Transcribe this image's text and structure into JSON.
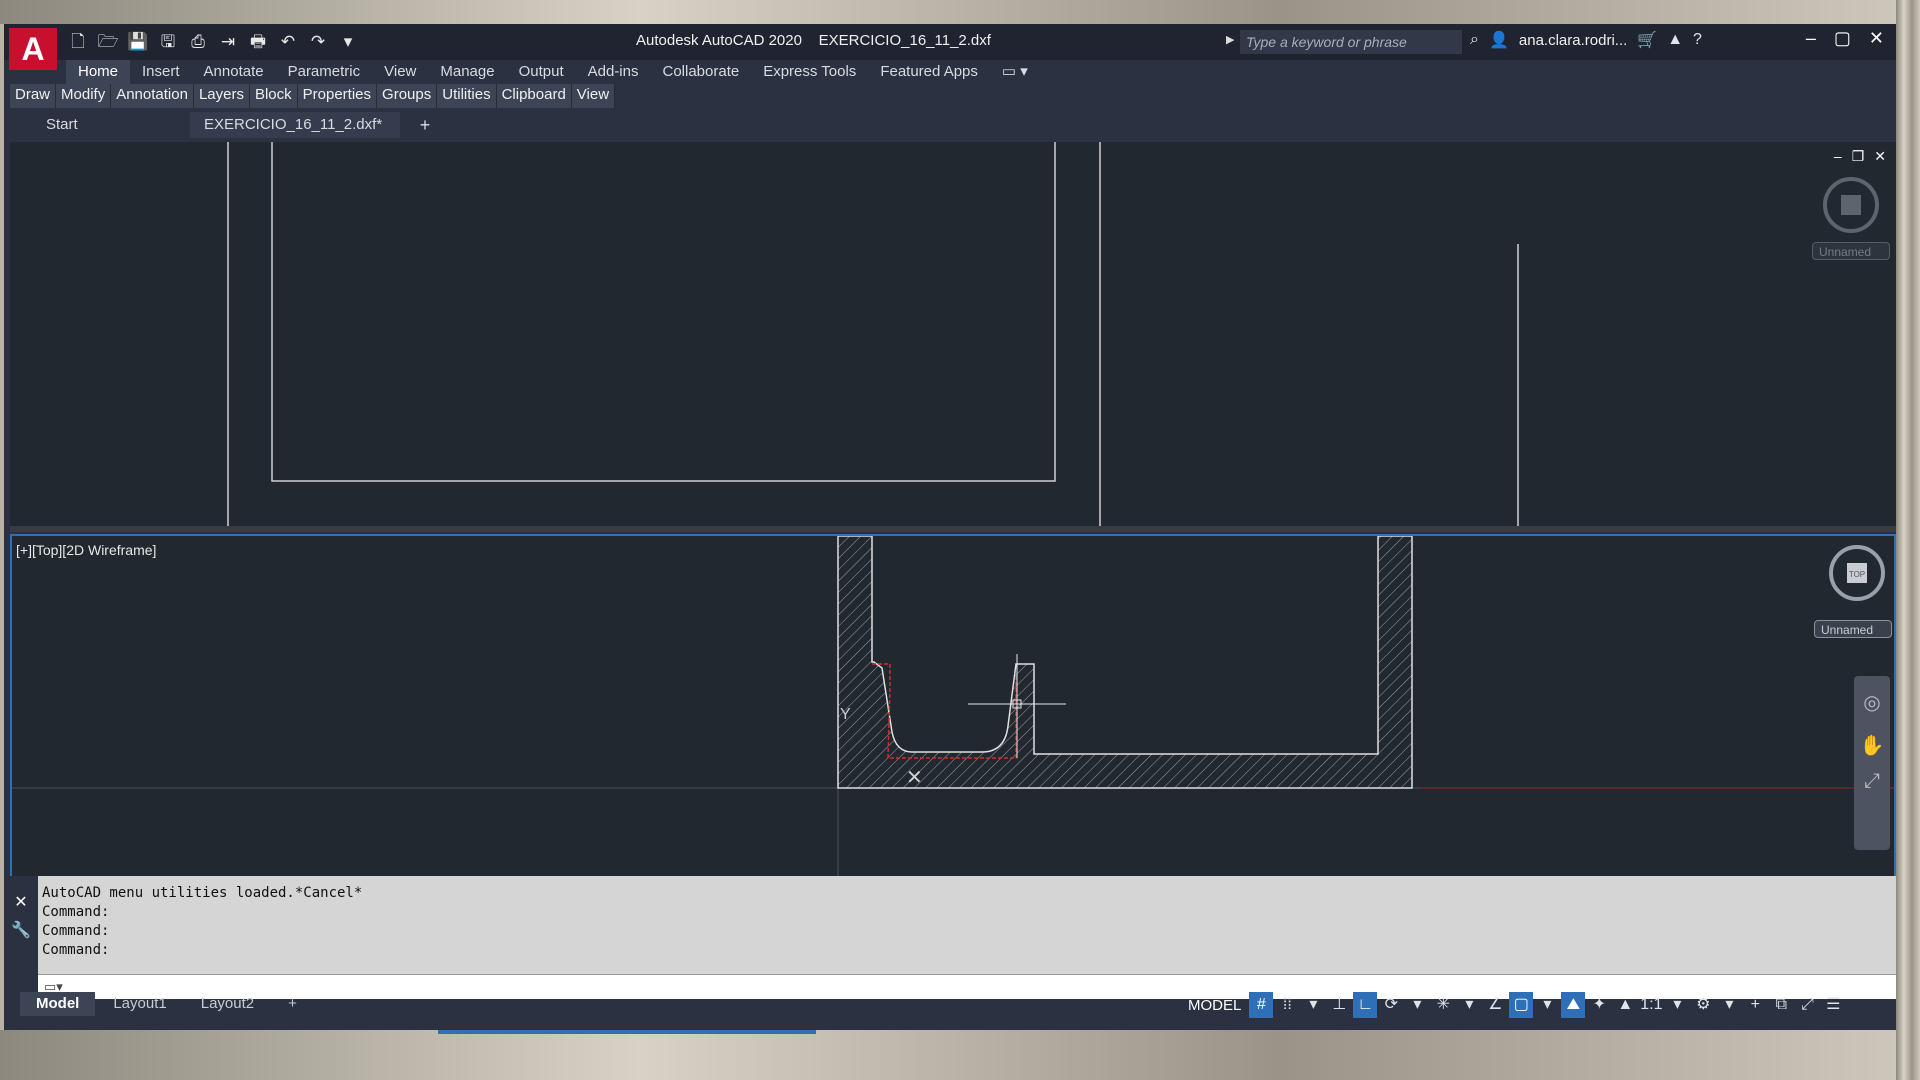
{
  "app": {
    "title": "Autodesk AutoCAD 2020    EXERCICIO_16_11_2.dxf",
    "logo_letter": "A",
    "accent": "#c8102e"
  },
  "qat": {
    "icons": [
      "new-icon",
      "open-icon",
      "save-icon",
      "save-as-icon",
      "plot-icon",
      "import-icon",
      "print-icon",
      "undo-icon",
      "redo-icon",
      "customize-icon"
    ],
    "glyphs": [
      "🗋",
      "🗁",
      "💾",
      "🖫",
      "⎙",
      "⇥",
      "🖶",
      "↶",
      "↷",
      "▾"
    ]
  },
  "search": {
    "placeholder": "Type a keyword or phrase"
  },
  "user": {
    "name": "ana.clara.rodri..."
  },
  "ribbon": {
    "tabs": [
      "Home",
      "Insert",
      "Annotate",
      "Parametric",
      "View",
      "Manage",
      "Output",
      "Add-ins",
      "Collaborate",
      "Express Tools",
      "Featured Apps"
    ],
    "panels": [
      "Draw",
      "Modify",
      "Annotation",
      "Layers",
      "Block",
      "Properties",
      "Groups",
      "Utilities",
      "Clipboard",
      "View"
    ]
  },
  "filetabs": {
    "start": "Start",
    "doc": "EXERCICIO_16_11_2.dxf*",
    "add": "+"
  },
  "viewport_bottom": {
    "label": "[+][Top][2D Wireframe]",
    "unnamed": "Unnamed",
    "viewcube_top": "TOP"
  },
  "viewport_top": {
    "unnamed": "Unnamed"
  },
  "command_history": [
    "AutoCAD menu utilities loaded.*Cancel*",
    "Command:",
    "Command:",
    "Command:"
  ],
  "layouts": [
    "Model",
    "Layout1",
    "Layout2",
    "+"
  ],
  "status": {
    "model": "MODEL",
    "scale": "1:1"
  }
}
